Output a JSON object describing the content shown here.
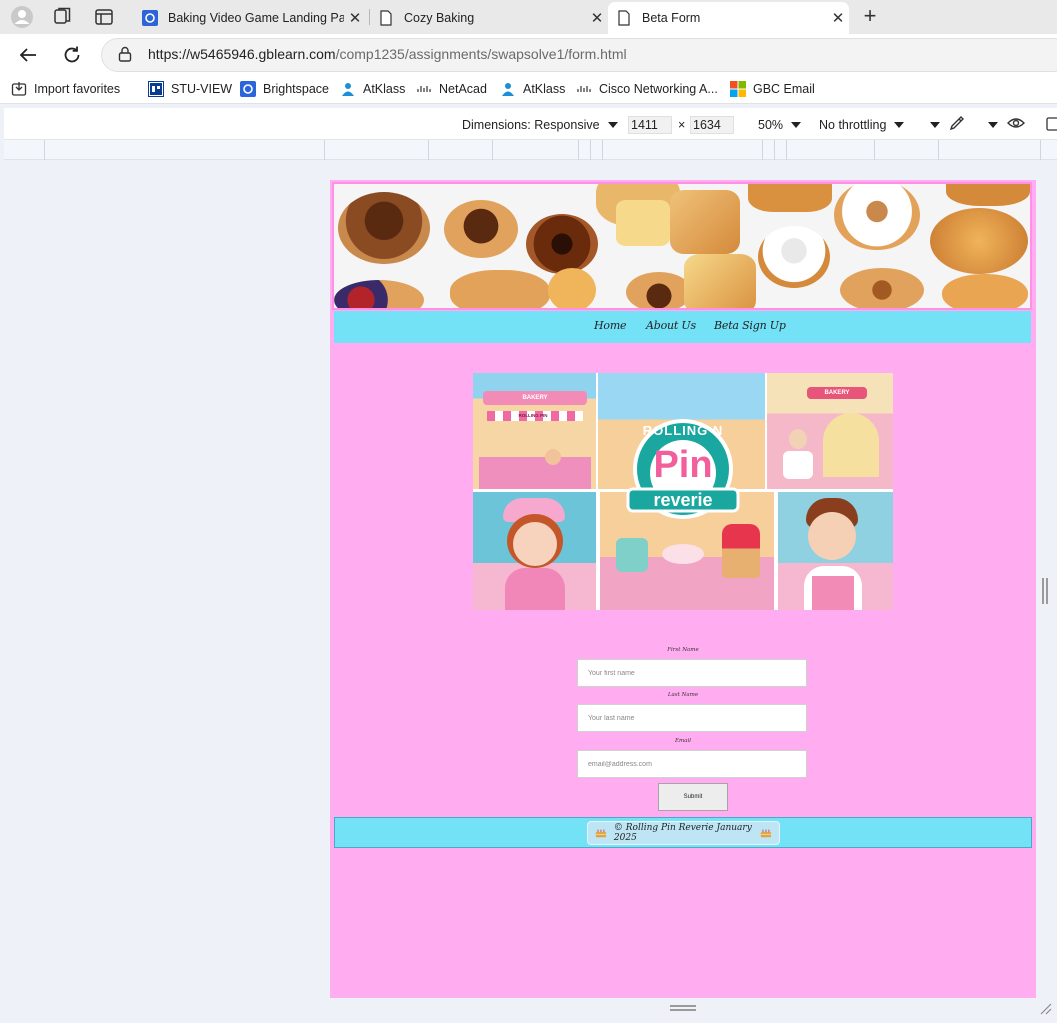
{
  "browser": {
    "tabs": [
      {
        "title": "Baking Video Game Landing Page",
        "active": false
      },
      {
        "title": "Cozy Baking",
        "active": false
      },
      {
        "title": "Beta Form",
        "active": true
      }
    ],
    "url_host": "https://w5465946.gblearn.com",
    "url_path": "/comp1235/assignments/swapsolve1/form.html"
  },
  "bookmarks": [
    {
      "label": "Import favorites",
      "icon": "import-icon"
    },
    {
      "label": "STU-VIEW",
      "icon": "gbc-icon"
    },
    {
      "label": "Brightspace",
      "icon": "brightspace-icon"
    },
    {
      "label": "AtKlass",
      "icon": "atklass-icon"
    },
    {
      "label": "NetAcad",
      "icon": "cisco-icon"
    },
    {
      "label": "AtKlass",
      "icon": "atklass-icon"
    },
    {
      "label": "Cisco Networking A...",
      "icon": "cisco-icon"
    },
    {
      "label": "GBC Email",
      "icon": "microsoft-icon"
    }
  ],
  "device_toolbar": {
    "dimensions": "Dimensions: Responsive",
    "width": "1411",
    "times": "×",
    "height": "1634",
    "zoom": "50%",
    "throttling": "No throttling"
  },
  "page": {
    "nav": [
      {
        "label": "Home"
      },
      {
        "label": "About Us"
      },
      {
        "label": "Beta Sign Up"
      }
    ],
    "logo": {
      "line1": "ROLLING N",
      "line2": "Pin",
      "line3": "reverie",
      "sign1": "BAKERY",
      "sign2": "ROLLING PIN",
      "sign3": "BAKERY"
    },
    "form": {
      "first_label": "First Name",
      "first_placeholder": "Your first name",
      "last_label": "Last Name",
      "last_placeholder": "Your last name",
      "email_label": "Email",
      "email_placeholder": "email@address.com",
      "submit": "Submit"
    },
    "footer": "© Rolling Pin Reverie January 2025"
  },
  "colors": {
    "page_bg": "#ffadf0",
    "nav_bg": "#74e2f6",
    "hero_border": "#ff90e6",
    "logo_teal": "#1aa7a0",
    "logo_pink": "#f25f9c"
  }
}
